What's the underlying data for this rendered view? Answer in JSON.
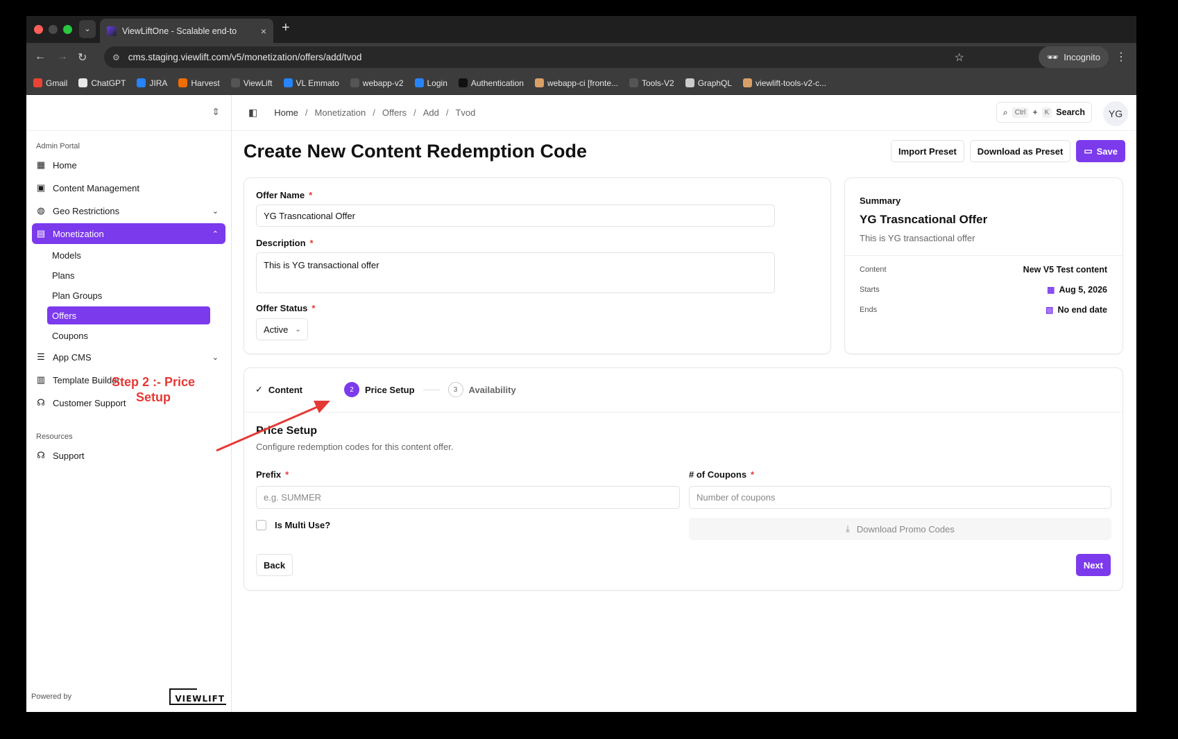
{
  "browser": {
    "tab_title": "ViewLiftOne - Scalable end-to",
    "url": "cms.staging.viewlift.com/v5/monetization/offers/add/tvod",
    "incognito_label": "Incognito",
    "bookmarks": [
      {
        "label": "Gmail",
        "color": "#ea4335"
      },
      {
        "label": "ChatGPT",
        "color": "#e8e8e8"
      },
      {
        "label": "JIRA",
        "color": "#2684ff"
      },
      {
        "label": "Harvest",
        "color": "#f36c00"
      },
      {
        "label": "ViewLift",
        "color": "#555555"
      },
      {
        "label": "VL Emmato",
        "color": "#2684ff"
      },
      {
        "label": "webapp-v2",
        "color": "#555555"
      },
      {
        "label": "Login",
        "color": "#2684ff"
      },
      {
        "label": "Authentication",
        "color": "#111111"
      },
      {
        "label": "webapp-ci [fronte...",
        "color": "#d9a066"
      },
      {
        "label": "Tools-V2",
        "color": "#555555"
      },
      {
        "label": "GraphQL",
        "color": "#cccccc"
      },
      {
        "label": "viewlift-tools-v2-c...",
        "color": "#d9a066"
      }
    ]
  },
  "sidebar": {
    "section_admin": "Admin Portal",
    "items": [
      {
        "label": "Home",
        "icon": "grid-icon"
      },
      {
        "label": "Content Management",
        "icon": "film-icon"
      },
      {
        "label": "Geo Restrictions",
        "icon": "globe-icon"
      },
      {
        "label": "Monetization",
        "icon": "wallet-icon"
      },
      {
        "label": "App CMS",
        "icon": "sliders-icon"
      },
      {
        "label": "Template Builder",
        "icon": "layout-icon"
      },
      {
        "label": "Customer Support",
        "icon": "headset-icon"
      }
    ],
    "sub_items": [
      "Models",
      "Plans",
      "Plan Groups",
      "Offers",
      "Coupons"
    ],
    "section_resources": "Resources",
    "support_label": "Support",
    "powered_by": "Powered by",
    "logo_text": "VIEWLIFT"
  },
  "annotation": {
    "text": "Step 2 :- Price Setup",
    "color": "#e53935"
  },
  "topbar": {
    "breadcrumb": [
      "Home",
      "Monetization",
      "Offers",
      "Add",
      "Tvod"
    ],
    "search_kbd1": "Ctrl",
    "search_plus": "+",
    "search_kbd2": "K",
    "search_label": "Search",
    "avatar": "YG"
  },
  "page": {
    "title": "Create New Content Redemption Code",
    "import_label": "Import Preset",
    "download_label": "Download as Preset",
    "save_label": "Save",
    "accent": "#7c3aed"
  },
  "form": {
    "offer_name_label": "Offer Name",
    "offer_name_value": "YG Trasncational Offer",
    "description_label": "Description",
    "description_value": "This is YG transactional offer",
    "status_label": "Offer Status",
    "status_value": "Active",
    "required_mark": "*"
  },
  "summary": {
    "label": "Summary",
    "title": "YG Trasncational Offer",
    "description": "This is YG transactional offer",
    "content_key": "Content",
    "content_value": "New V5 Test content",
    "starts_key": "Starts",
    "starts_value": "Aug 5, 2026",
    "ends_key": "Ends",
    "ends_value": "No end date"
  },
  "steps": {
    "items": [
      {
        "num": "",
        "label": "Content",
        "state": "done"
      },
      {
        "num": "2",
        "label": "Price Setup",
        "state": "active"
      },
      {
        "num": "3",
        "label": "Availability",
        "state": "pending"
      }
    ],
    "section_title": "Price Setup",
    "section_desc": "Configure redemption codes for this content offer.",
    "prefix_label": "Prefix",
    "prefix_placeholder": "e.g. SUMMER",
    "coupons_label": "# of Coupons",
    "coupons_placeholder": "Number of coupons",
    "multi_use_label": "Is Multi Use?",
    "download_codes_label": "Download Promo Codes",
    "back_label": "Back",
    "next_label": "Next"
  }
}
